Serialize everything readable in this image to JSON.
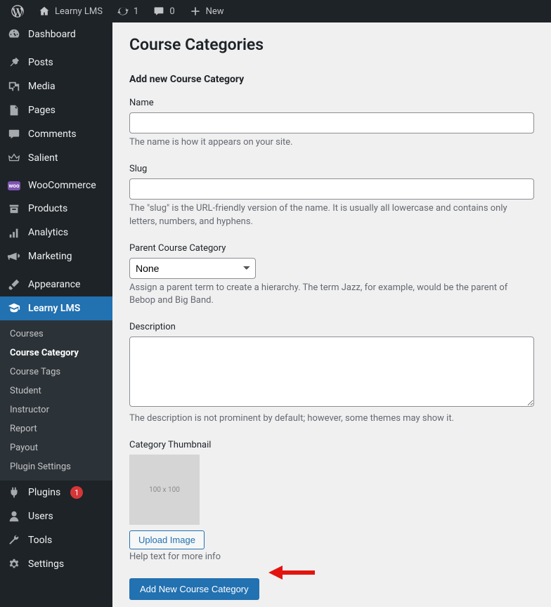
{
  "adminbar": {
    "site_name": "Learny LMS",
    "updates_count": "1",
    "comments_count": "0",
    "new_label": "New"
  },
  "sidebar": {
    "items": [
      {
        "label": "Dashboard"
      },
      {
        "label": "Posts"
      },
      {
        "label": "Media"
      },
      {
        "label": "Pages"
      },
      {
        "label": "Comments"
      },
      {
        "label": "Salient"
      },
      {
        "label": "WooCommerce"
      },
      {
        "label": "Products"
      },
      {
        "label": "Analytics"
      },
      {
        "label": "Marketing"
      },
      {
        "label": "Appearance"
      },
      {
        "label": "Learny LMS"
      },
      {
        "label": "Plugins",
        "badge": "1"
      },
      {
        "label": "Users"
      },
      {
        "label": "Tools"
      },
      {
        "label": "Settings"
      }
    ],
    "submenu": [
      "Courses",
      "Course Category",
      "Course Tags",
      "Student",
      "Instructor",
      "Report",
      "Payout",
      "Plugin Settings"
    ]
  },
  "page": {
    "title": "Course Categories",
    "section_title": "Add new Course Category",
    "name": {
      "label": "Name",
      "value": "",
      "help": "The name is how it appears on your site."
    },
    "slug": {
      "label": "Slug",
      "value": "",
      "help": "The \"slug\" is the URL-friendly version of the name. It is usually all lowercase and contains only letters, numbers, and hyphens."
    },
    "parent": {
      "label": "Parent Course Category",
      "selected": "None",
      "help": "Assign a parent term to create a hierarchy. The term Jazz, for example, would be the parent of Bebop and Big Band."
    },
    "description": {
      "label": "Description",
      "value": "",
      "help": "The description is not prominent by default; however, some themes may show it."
    },
    "thumbnail": {
      "label": "Category Thumbnail",
      "placeholder_text": "100 x 100",
      "upload_button": "Upload Image",
      "help": "Help text for more info"
    },
    "submit_label": "Add New Course Category"
  }
}
